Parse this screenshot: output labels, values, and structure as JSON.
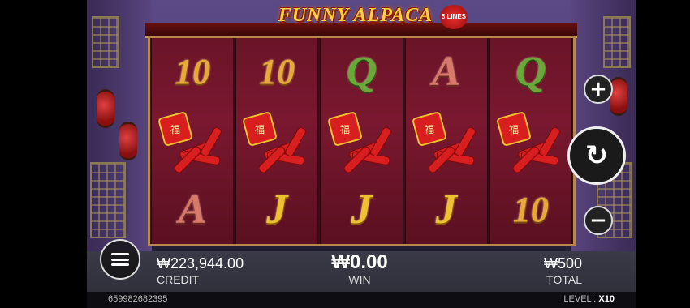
{
  "game": {
    "title": "FUNNY ALPACA",
    "lines_badge": "5 LINES"
  },
  "reels": [
    [
      "10",
      "firecracker",
      "A"
    ],
    [
      "10",
      "firecracker",
      "J"
    ],
    [
      "Q",
      "firecracker",
      "J"
    ],
    [
      "A",
      "firecracker",
      "J"
    ],
    [
      "Q",
      "firecracker",
      "10"
    ]
  ],
  "symbols": {
    "10": "10",
    "Q": "Q",
    "A": "A",
    "J": "J"
  },
  "controls": {
    "plus": "+",
    "minus": "−",
    "spin": "↻"
  },
  "info": {
    "credit_value": "₩223,944.00",
    "credit_label": "CREDIT",
    "win_value": "₩0.00",
    "win_label": "WIN",
    "total_value": "₩500",
    "total_label": "TOTAL"
  },
  "footer": {
    "session_id": "659982682395",
    "level_label": "LEVEL :",
    "level_value": "X10"
  },
  "colors": {
    "reel_bg": "#6a1428",
    "frame": "#b8884a",
    "title": "#ffd23a"
  }
}
